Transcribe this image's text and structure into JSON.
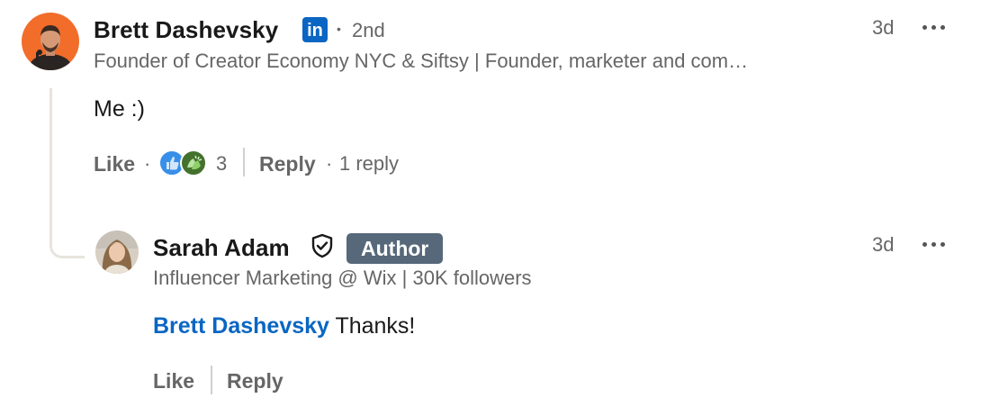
{
  "colors": {
    "link_blue": "#0a66c2",
    "muted_text": "#666666",
    "author_badge_bg": "#56687a",
    "linkedin_blue": "#0a66c2"
  },
  "comment": {
    "author_name": "Brett Dashevsky",
    "badge_icon": "linkedin-logo-icon",
    "badge_text": "in",
    "separator": "•",
    "degree": "2nd",
    "headline": "Founder of Creator Economy NYC & Siftsy | Founder, marketer and com…",
    "timestamp": "3d",
    "body": "Me :)",
    "actions": {
      "like_label": "Like",
      "reaction_separator": "·",
      "reaction_icons": [
        "like-reaction-icon",
        "celebrate-reaction-icon"
      ],
      "reaction_count": "3",
      "reply_label": "Reply",
      "reply_separator": "·",
      "reply_count_text": "1 reply"
    }
  },
  "reply": {
    "author_name": "Sarah Adam",
    "verified_icon": "shield-check-icon",
    "author_badge": "Author",
    "headline": "Influencer Marketing @ Wix | 30K followers",
    "timestamp": "3d",
    "mention": "Brett Dashevsky",
    "body": "Thanks!",
    "actions": {
      "like_label": "Like",
      "reply_label": "Reply"
    }
  }
}
